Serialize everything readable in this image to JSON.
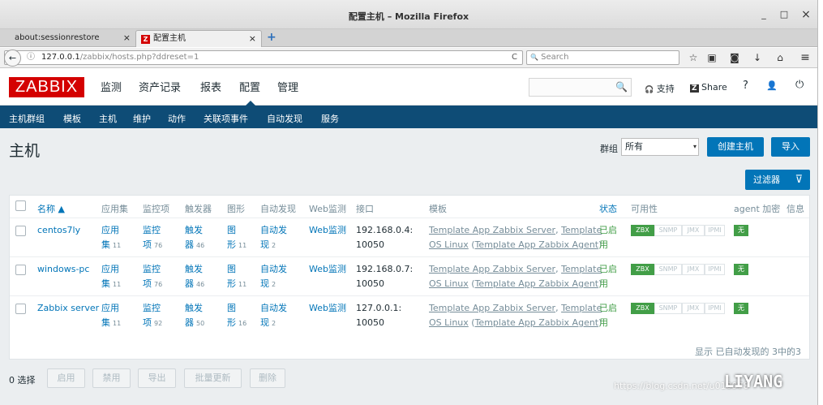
{
  "window": {
    "title": "配置主机 – Mozilla Firefox",
    "minimize": "_",
    "maximize": "□",
    "close": "×"
  },
  "tabs": [
    {
      "label": "about:sessionrestore",
      "close": "×"
    },
    {
      "label": "配置主机",
      "close": "×",
      "favicon": "Z"
    }
  ],
  "new_tab": "+",
  "browser": {
    "url_host": "127.0.0.1",
    "url_path": "/zabbix/hosts.php?ddreset=1",
    "search_placeholder": "Search",
    "back": "←",
    "info": "ⓘ",
    "reload": "C",
    "search_icon": "🔍",
    "star": "☆",
    "reader": "▣",
    "pocket": "◙",
    "download": "↓",
    "home": "⌂",
    "menu": "≡"
  },
  "zabbix": {
    "logo": "ZABBIX",
    "menu": [
      "监测",
      "资产记录",
      "报表",
      "配置",
      "管理"
    ],
    "support": "支持",
    "share": "Share",
    "help": "?",
    "user": "👤",
    "power": "⏻",
    "search_icon": "🔍",
    "support_icon": "🎧",
    "share_icon": "Z"
  },
  "submenu": [
    "主机群组",
    "模板",
    "主机",
    "维护",
    "动作",
    "关联项事件",
    "自动发现",
    "服务"
  ],
  "page": {
    "title": "主机",
    "group_label": "群组",
    "group_value": "所有",
    "group_arrow": "▾",
    "create_host": "创建主机",
    "import": "导入",
    "filter": "过滤器",
    "filter_icon": "⊽"
  },
  "table": {
    "headers": [
      "名称 ▲",
      "应用集",
      "监控项",
      "触发器",
      "图形",
      "自动发现",
      "Web监测",
      "接口",
      "模板",
      "状态",
      "可用性",
      "agent 加密",
      "信息"
    ],
    "rows": [
      {
        "name": "centos7ly",
        "app_l1": "应用",
        "app_l2": "集",
        "app_n": "11",
        "item_l1": "监控",
        "item_l2": "项",
        "item_n": "76",
        "trig_l1": "触发",
        "trig_l2": "器",
        "trig_n": "46",
        "graph_l1": "图",
        "graph_l2": "形",
        "graph_n": "11",
        "disc_l1": "自动发",
        "disc_l2": "现",
        "disc_n": "2",
        "web": "Web监测",
        "iface_l1": "192.168.0.4:",
        "iface_l2": "10050",
        "tpl_a": "Template App Zabbix Server",
        "tpl_sep": ", ",
        "tpl_b1": "Template",
        "tpl_b2": "OS Linux",
        "tpl_c_open": " (",
        "tpl_c": "Template App Zabbix Agent",
        "tpl_c_close": ")",
        "status_l1": "已启",
        "status_l2": "用",
        "zbx": "ZBX",
        "snmp": "SNMP",
        "jmx": "JMX",
        "ipmi": "IPMI",
        "enc": "无"
      },
      {
        "name": "windows-pc",
        "app_l1": "应用",
        "app_l2": "集",
        "app_n": "11",
        "item_l1": "监控",
        "item_l2": "项",
        "item_n": "76",
        "trig_l1": "触发",
        "trig_l2": "器",
        "trig_n": "46",
        "graph_l1": "图",
        "graph_l2": "形",
        "graph_n": "11",
        "disc_l1": "自动发",
        "disc_l2": "现",
        "disc_n": "2",
        "web": "Web监测",
        "iface_l1": "192.168.0.7:",
        "iface_l2": "10050",
        "tpl_a": "Template App Zabbix Server",
        "tpl_sep": ", ",
        "tpl_b1": "Template",
        "tpl_b2": "OS Linux",
        "tpl_c_open": " (",
        "tpl_c": "Template App Zabbix Agent",
        "tpl_c_close": ")",
        "status_l1": "已启",
        "status_l2": "用",
        "zbx": "ZBX",
        "snmp": "SNMP",
        "jmx": "JMX",
        "ipmi": "IPMI",
        "enc": "无"
      },
      {
        "name": "Zabbix server",
        "app_l1": "应用",
        "app_l2": "集",
        "app_n": "11",
        "item_l1": "监控",
        "item_l2": "项",
        "item_n": "92",
        "trig_l1": "触发",
        "trig_l2": "器",
        "trig_n": "50",
        "graph_l1": "图",
        "graph_l2": "形",
        "graph_n": "16",
        "disc_l1": "自动发",
        "disc_l2": "现",
        "disc_n": "2",
        "web": "Web监测",
        "iface_l1": "127.0.0.1:",
        "iface_l2": "10050",
        "tpl_a": "Template App Zabbix Server",
        "tpl_sep": ", ",
        "tpl_b1": "Template",
        "tpl_b2": "OS Linux",
        "tpl_c_open": " (",
        "tpl_c": "Template App Zabbix Agent",
        "tpl_c_close": ")",
        "status_l1": "已启",
        "status_l2": "用",
        "zbx": "ZBX",
        "snmp": "SNMP",
        "jmx": "JMX",
        "ipmi": "IPMI",
        "enc": "无"
      }
    ],
    "footer": "显示 已自动发现的 3中的3"
  },
  "actions": {
    "selected": "0 选择",
    "buttons": [
      "启用",
      "禁用",
      "导出",
      "批量更新",
      "删除"
    ]
  },
  "watermark": {
    "text": "https://blog.csdn.net/u010978",
    "logo": "LIYANG"
  },
  "colors": {
    "brand": "#d40000",
    "nav": "#0e4c76",
    "primary": "#0275b8",
    "success": "#429e47"
  }
}
